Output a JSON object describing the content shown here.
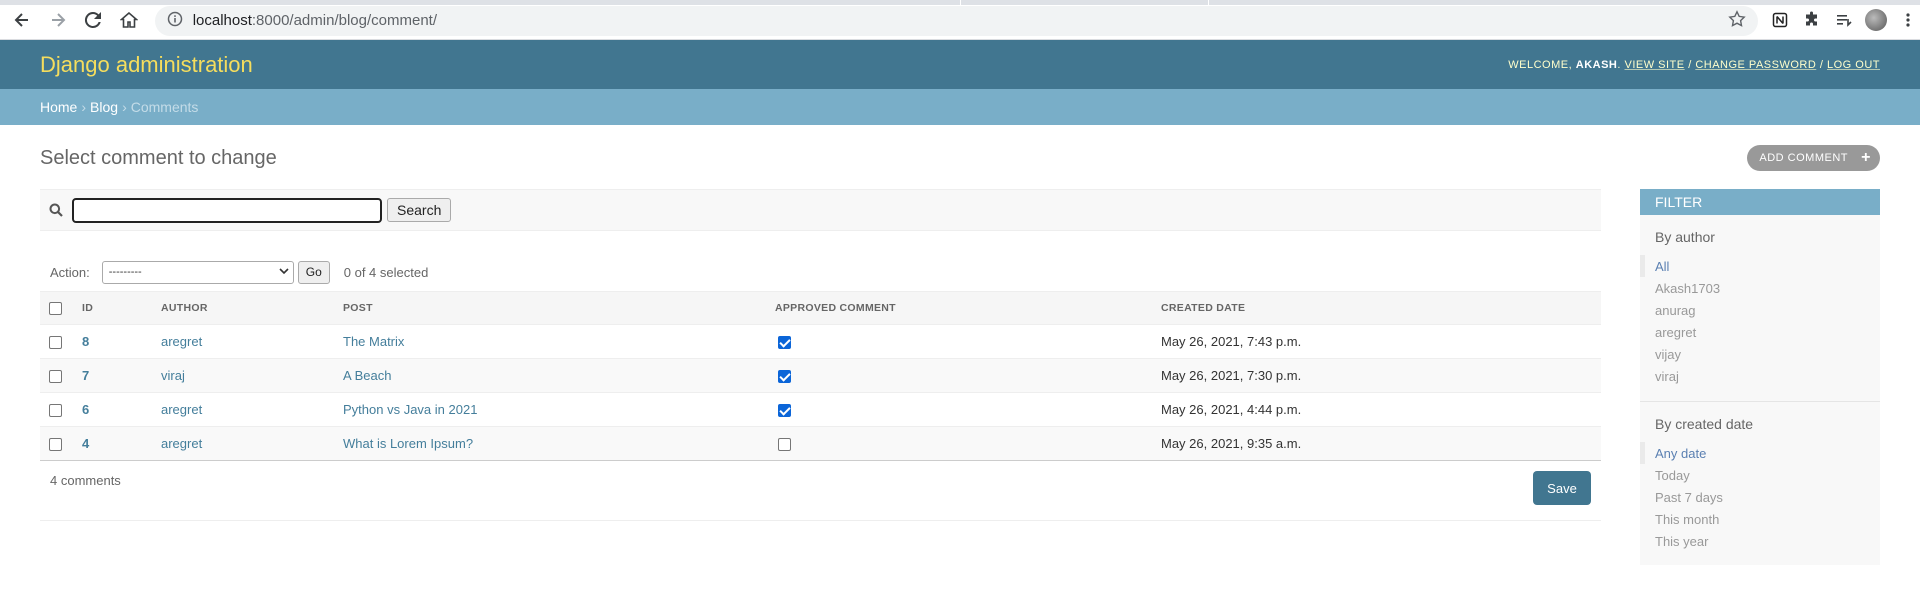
{
  "browser": {
    "url_host": "localhost",
    "url_rest": ":8000/admin/blog/comment/"
  },
  "header": {
    "brand": "Django administration",
    "welcome": "WELCOME,",
    "username": "AKASH",
    "view_site": "VIEW SITE",
    "change_password": "CHANGE PASSWORD",
    "log_out": "LOG OUT",
    "sep": "/",
    "colors": {
      "header_bg": "#417690",
      "brand": "#f5dd5d",
      "breadcrumb_bg": "#79aec8"
    }
  },
  "breadcrumbs": {
    "home": "Home",
    "app": "Blog",
    "current": "Comments",
    "sep": "›"
  },
  "page": {
    "title": "Select comment to change",
    "add_button": "ADD COMMENT",
    "add_plus": "+"
  },
  "search": {
    "button": "Search",
    "value": ""
  },
  "actions": {
    "label": "Action:",
    "selected_option": "---------",
    "go": "Go",
    "counter": "0 of 4 selected"
  },
  "table": {
    "columns": {
      "id": "ID",
      "author": "AUTHOR",
      "post": "POST",
      "approved": "APPROVED COMMENT",
      "created": "CREATED DATE"
    },
    "rows": [
      {
        "id": "8",
        "author": "aregret",
        "post": "The Matrix",
        "approved": true,
        "created": "May 26, 2021, 7:43 p.m."
      },
      {
        "id": "7",
        "author": "viraj",
        "post": "A Beach",
        "approved": true,
        "created": "May 26, 2021, 7:30 p.m."
      },
      {
        "id": "6",
        "author": "aregret",
        "post": "Python vs Java in 2021",
        "approved": true,
        "created": "May 26, 2021, 4:44 p.m."
      },
      {
        "id": "4",
        "author": "aregret",
        "post": "What is Lorem Ipsum?",
        "approved": false,
        "created": "May 26, 2021, 9:35 a.m."
      }
    ]
  },
  "paginator": {
    "count": "4 comments",
    "save": "Save"
  },
  "filter": {
    "title": "FILTER",
    "by_author": {
      "heading": "By author",
      "options": [
        "All",
        "Akash1703",
        "anurag",
        "aregret",
        "vijay",
        "viraj"
      ],
      "selected": "All"
    },
    "by_created": {
      "heading": "By created date",
      "options": [
        "Any date",
        "Today",
        "Past 7 days",
        "This month",
        "This year"
      ],
      "selected": "Any date"
    }
  }
}
